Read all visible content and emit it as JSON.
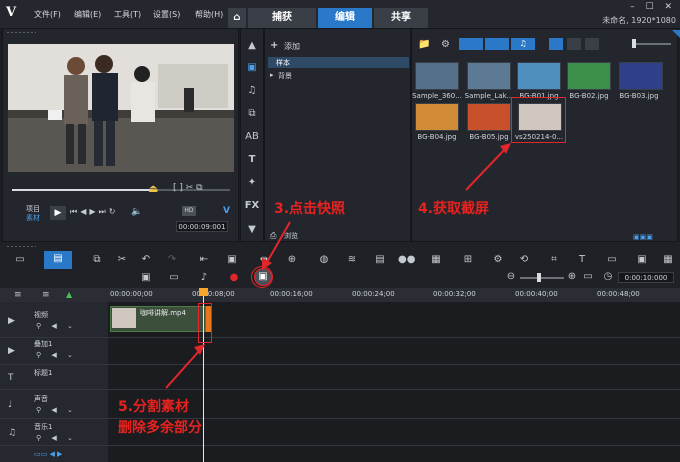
{
  "menu": [
    "文件(F)",
    "编辑(E)",
    "工具(T)",
    "设置(S)",
    "帮助(H)"
  ],
  "tabs": [
    "捕获",
    "编辑",
    "共享"
  ],
  "project_info": "未命名, 1920*1080",
  "preview": {
    "mode_labels": [
      "项目",
      "素材"
    ],
    "timecode": "00:00:09:001",
    "resolution": "HD"
  },
  "library": {
    "add_label": "添加",
    "tree": [
      "样本",
      "背景"
    ],
    "browse_label": "浏览"
  },
  "thumbnails": [
    {
      "name": "Sample_360...",
      "color": "#55708a"
    },
    {
      "name": "Sample_Lak...",
      "color": "#5d7a95"
    },
    {
      "name": "BG-B01.jpg",
      "color": "#4f8fbf"
    },
    {
      "name": "BG-B02.jpg",
      "color": "#3c8f4a"
    },
    {
      "name": "BG-B03.jpg",
      "color": "#2f3f8a"
    },
    {
      "name": "BG-B04.jpg",
      "color": "#d18a35"
    },
    {
      "name": "BG-B05.jpg",
      "color": "#c8502a"
    },
    {
      "name": "vs250214-0...",
      "color": "#cfc7bd"
    }
  ],
  "timeline": {
    "ruler": [
      "00:00:00;00",
      "00:00:08;00",
      "00:00:16;00",
      "00:00:24;00",
      "00:00:32;00",
      "00:00:40;00",
      "00:00:48;00"
    ],
    "tracks": [
      "视频",
      "叠加1",
      "标题1",
      "声音",
      "音乐1"
    ],
    "clip_name": "咖啡讲解.mp4",
    "zoom_timecode": "0:00:10:000",
    "tooltip": "快照"
  },
  "annotations": {
    "step3": "3.点击快照",
    "step4": "4.获取截屏",
    "step5_line1": "5.分割素材",
    "step5_line2": "删除多余部分"
  },
  "colors": {
    "accent": "#2a79c8",
    "highlight": "#e2262a",
    "playhead": "#f7a52a"
  }
}
